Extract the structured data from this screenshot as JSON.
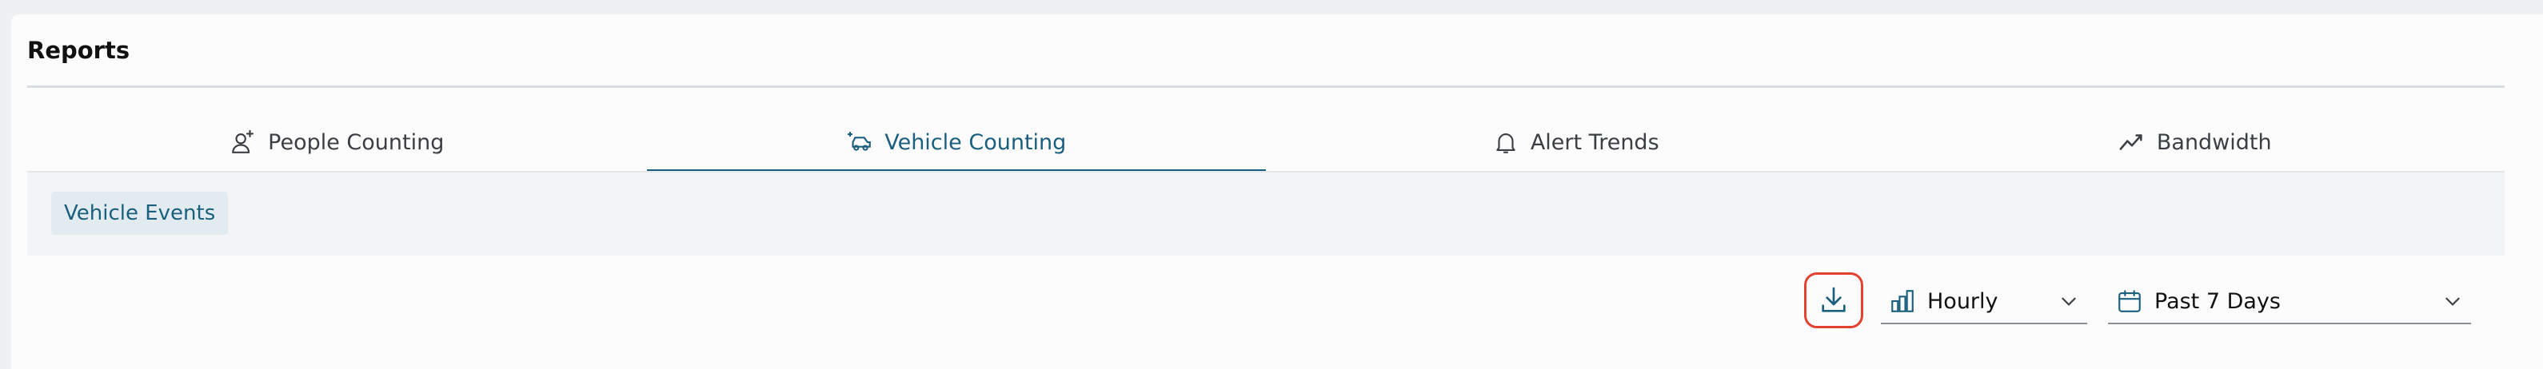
{
  "page": {
    "title": "Reports"
  },
  "tabs": [
    {
      "label": "People Counting",
      "icon": "person-add-icon",
      "active": false
    },
    {
      "label": "Vehicle Counting",
      "icon": "vehicle-icon",
      "active": true
    },
    {
      "label": "Alert Trends",
      "icon": "bell-icon",
      "active": false
    },
    {
      "label": "Bandwidth",
      "icon": "trend-line-icon",
      "active": false
    }
  ],
  "subtabs": [
    {
      "label": "Vehicle Events",
      "active": true
    }
  ],
  "toolbar": {
    "download_icon": "download-icon",
    "interval": {
      "value": "Hourly",
      "icon": "bar-chart-icon"
    },
    "range": {
      "value": "Past 7 Days",
      "icon": "calendar-icon"
    }
  },
  "colors": {
    "accent": "#1b5f7e",
    "highlight_border": "#e4412f",
    "chip_bg": "#e2ecf0"
  }
}
